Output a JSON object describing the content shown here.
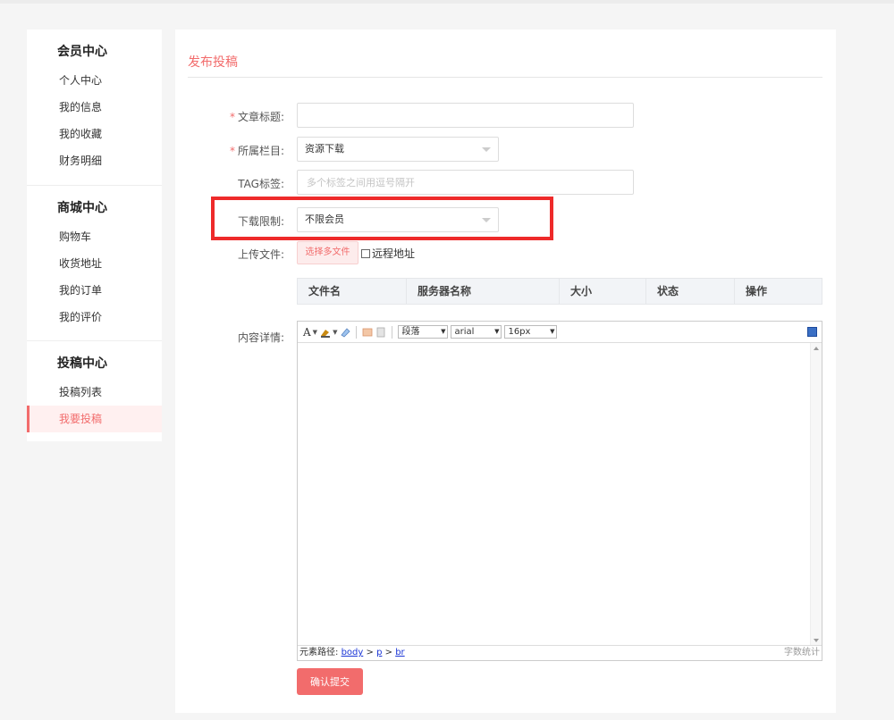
{
  "sidebar": {
    "groups": [
      {
        "title": "会员中心",
        "items": [
          "个人中心",
          "我的信息",
          "我的收藏",
          "财务明细"
        ]
      },
      {
        "title": "商城中心",
        "items": [
          "购物车",
          "收货地址",
          "我的订单",
          "我的评价"
        ]
      },
      {
        "title": "投稿中心",
        "items": [
          "投稿列表",
          "我要投稿"
        ]
      }
    ],
    "active_item": "我要投稿"
  },
  "page": {
    "title": "发布投稿"
  },
  "form": {
    "title_label": "文章标题:",
    "title_value": "",
    "column_label": "所属栏目:",
    "column_value": "资源下载",
    "tag_label": "TAG标签:",
    "tag_placeholder": "多个标签之间用逗号隔开",
    "download_label": "下载限制:",
    "download_value": "不限会员",
    "upload_label": "上传文件:",
    "upload_button": "选择多文件",
    "remote_label": "远程地址",
    "remote_checked": false,
    "content_label": "内容详情:",
    "required_mark": "*"
  },
  "file_table": {
    "columns": [
      "文件名",
      "服务器名称",
      "大小",
      "状态",
      "操作"
    ]
  },
  "editor": {
    "toolbar": {
      "font_color": "A",
      "paragraph": "段落",
      "font_family": "arial",
      "font_size": "16px"
    },
    "path_label": "元素路径:",
    "path": [
      "body",
      "p",
      "br"
    ],
    "path_sep": ">",
    "word_count": "字数统计"
  },
  "submit_label": "确认提交",
  "colors": {
    "accent": "#f26c6c",
    "highlight": "#ee2a2a"
  }
}
